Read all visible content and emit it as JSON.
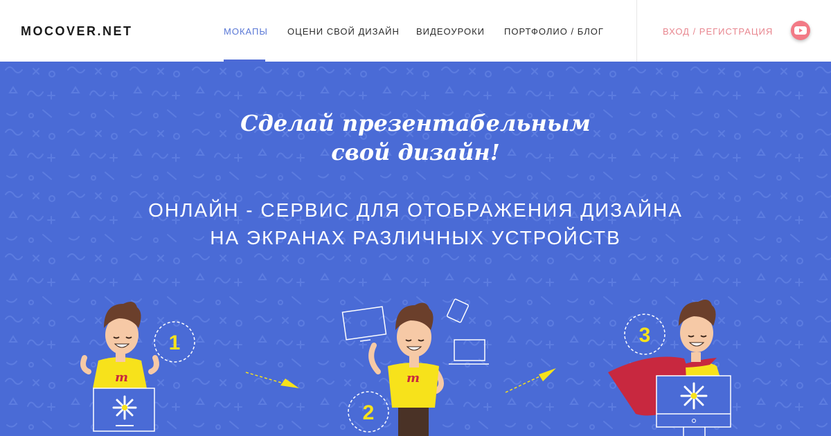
{
  "header": {
    "logo": "MOCOVER.NET",
    "nav": [
      {
        "label": "МОКАПЫ",
        "active": true
      },
      {
        "label": "ОЦЕНИ СВОЙ ДИЗАЙН",
        "active": false
      },
      {
        "label": "ВИДЕОУРОКИ",
        "active": false
      },
      {
        "label": "ПОРТФОЛИО / БЛОГ",
        "active": false
      }
    ],
    "login": "ВХОД / РЕГИСТРАЦИЯ",
    "social_icon": "youtube-icon"
  },
  "hero": {
    "tagline_line1": "Сделай презентабельным",
    "tagline_line2": "свой дизайн!",
    "subtitle_line1": "ОНЛАЙН - СЕРВИС ДЛЯ ОТОБРАЖЕНИЯ ДИЗАЙНА",
    "subtitle_line2": "НА ЭКРАНАХ РАЗЛИЧНЫХ УСТРОЙСТВ",
    "steps": [
      "1",
      "2",
      "3"
    ],
    "shirt_letter": "m"
  },
  "colors": {
    "hero_bg": "#4a6bd6",
    "accent": "#5a78d6",
    "login": "#e8868f",
    "youtube": "#f27a86",
    "yellow": "#f7e21b",
    "cape": "#c8283f"
  }
}
